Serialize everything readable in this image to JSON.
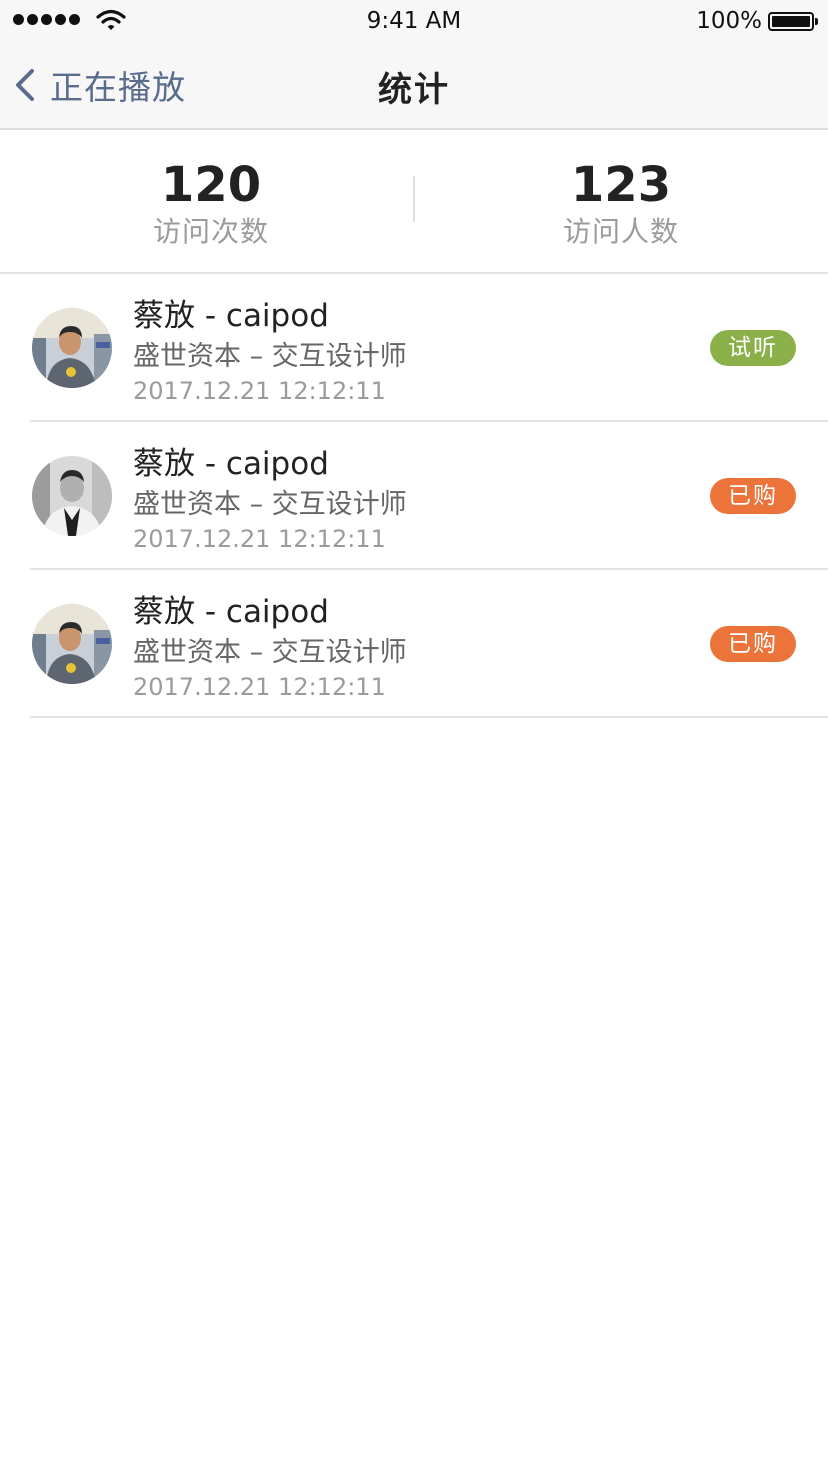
{
  "status_bar": {
    "time": "9:41 AM",
    "battery": "100%",
    "signal_icon": "signal-dots-icon",
    "wifi_icon": "wifi-icon",
    "battery_icon": "battery-icon"
  },
  "nav": {
    "back_label": "正在播放",
    "back_icon": "chevron-left-icon",
    "title": "统计"
  },
  "stats": [
    {
      "value": "120",
      "label": "访问次数"
    },
    {
      "value": "123",
      "label": "访问人数"
    }
  ],
  "visitors": [
    {
      "name": "蔡放 - caipod",
      "company": "盛世资本 – 交互设计师",
      "time": "2017.12.21 12:12:11",
      "badge": "试听",
      "badge_color": "#8bb04a",
      "avatar": "color-photo"
    },
    {
      "name": "蔡放 - caipod",
      "company": "盛世资本 – 交互设计师",
      "time": "2017.12.21 12:12:11",
      "badge": "已购",
      "badge_color": "#ec7339",
      "avatar": "bw-photo"
    },
    {
      "name": "蔡放 - caipod",
      "company": "盛世资本 – 交互设计师",
      "time": "2017.12.21 12:12:11",
      "badge": "已购",
      "badge_color": "#ec7339",
      "avatar": "color-photo"
    }
  ],
  "colors": {
    "bar_background": "#f7f7f8",
    "back_tint": "#5a6b8c",
    "trial_badge": "#8bb04a",
    "purchased_badge": "#ec7339"
  }
}
